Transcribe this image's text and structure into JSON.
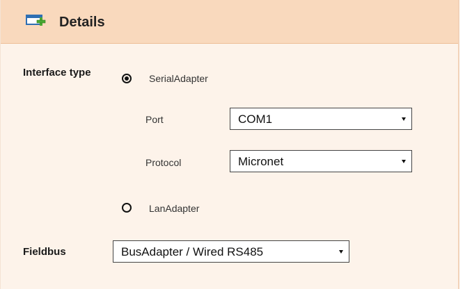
{
  "header": {
    "title": "Details",
    "icon": "add-window-icon"
  },
  "interface": {
    "label": "Interface type",
    "options": [
      {
        "label": "SerialAdapter",
        "selected": true
      },
      {
        "label": "LanAdapter",
        "selected": false
      }
    ],
    "port": {
      "label": "Port",
      "value": "COM1"
    },
    "protocol": {
      "label": "Protocol",
      "value": "Micronet"
    }
  },
  "fieldbus": {
    "label": "Fieldbus",
    "value": "BusAdapter / Wired RS485"
  },
  "colors": {
    "header_bg": "#f9d9bd",
    "panel_bg": "#fdf3ea",
    "icon_green": "#4aa832",
    "icon_blue": "#2f6fb3"
  }
}
